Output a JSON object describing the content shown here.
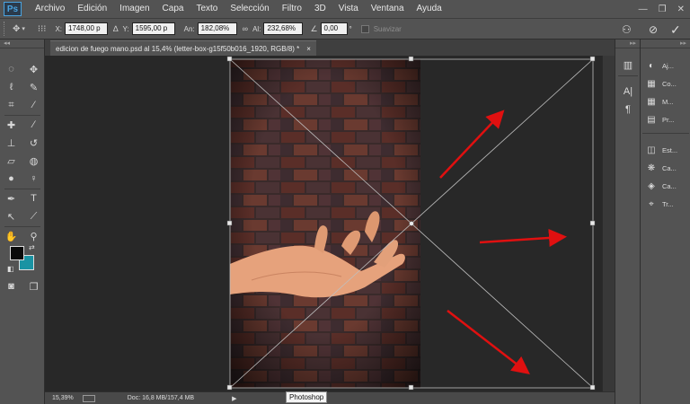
{
  "app": {
    "logo": "Ps",
    "name": "Photoshop"
  },
  "menu": [
    "Archivo",
    "Edición",
    "Imagen",
    "Capa",
    "Texto",
    "Selección",
    "Filtro",
    "3D",
    "Vista",
    "Ventana",
    "Ayuda"
  ],
  "window_controls": {
    "minimize": "—",
    "maximize": "❐",
    "close": "✕"
  },
  "options": {
    "x_label": "X:",
    "x_value": "1748,00 p",
    "y_label": "Y:",
    "y_value": "1595,00 p",
    "w_label": "An:",
    "w_value": "182,08%",
    "h_label": "Al:",
    "h_value": "232,68%",
    "angle_value": "0,00",
    "angle_unit": "°",
    "smooth_label": "Suavizar"
  },
  "document": {
    "tab_title": "edicion de fuego mano.psd al 15,4% (letter-box-g15f50b016_1920, RGB/8) *",
    "close": "×"
  },
  "status": {
    "zoom": "15,39%",
    "doc_info": "Doc: 16,8 MB/157,4 MB",
    "tooltip": "Photoshop"
  },
  "colors": {
    "foreground": "#0a0a0a",
    "background": "#1a93a3",
    "arrow": "#e01010"
  },
  "panels": [
    {
      "icon": "adjustments-icon",
      "label": "Aj..."
    },
    {
      "icon": "color-icon",
      "label": "Co..."
    },
    {
      "icon": "swatches-icon",
      "label": "M..."
    },
    {
      "icon": "properties-icon",
      "label": "Pr..."
    },
    {
      "icon": "styles-icon",
      "label": "Est..."
    },
    {
      "icon": "channels-icon",
      "label": "Ca..."
    },
    {
      "icon": "layers-icon",
      "label": "Ca..."
    },
    {
      "icon": "paths-icon",
      "label": "Tr..."
    }
  ]
}
